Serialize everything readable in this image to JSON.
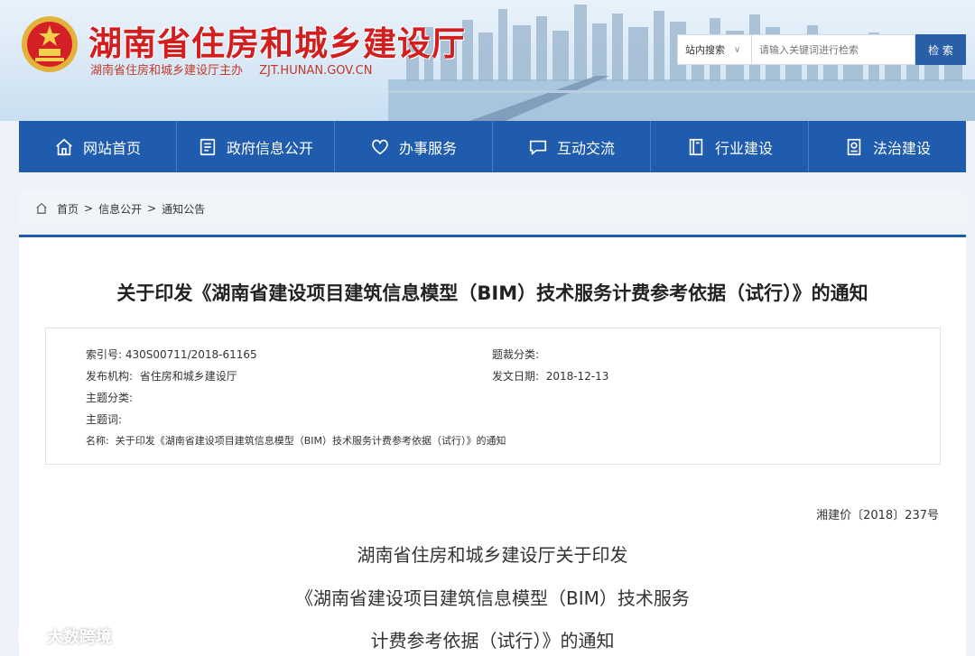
{
  "header": {
    "site_title": "湖南省住房和城乡建设厅",
    "sponsor": "湖南省住房和城乡建设厅主办",
    "domain": "ZJT.HUNAN.GOV.CN",
    "search_scope": "站内搜索",
    "search_placeholder": "请输入关键词进行检索",
    "search_button": "检 索"
  },
  "nav": {
    "items": [
      {
        "label": "网站首页",
        "icon": "home-icon"
      },
      {
        "label": "政府信息公开",
        "icon": "document-icon"
      },
      {
        "label": "办事服务",
        "icon": "heart-icon"
      },
      {
        "label": "互动交流",
        "icon": "chat-icon"
      },
      {
        "label": "行业建设",
        "icon": "book-icon"
      },
      {
        "label": "法治建设",
        "icon": "law-icon"
      }
    ]
  },
  "breadcrumb": {
    "items": [
      "首页",
      "信息公开",
      "通知公告"
    ],
    "sep": ">"
  },
  "article": {
    "title": "关于印发《湖南省建设项目建筑信息模型（BIM）技术服务计费参考依据（试行）》的通知",
    "meta": {
      "index_label": "索引号:",
      "index_value": "430S00711/2018-61165",
      "genre_label": "题裁分类:",
      "genre_value": "",
      "publisher_label": "发布机构:",
      "publisher_value": "省住房和城乡建设厅",
      "date_label": "发文日期:",
      "date_value": "2018-12-13",
      "topic_label": "主题分类:",
      "topic_value": "",
      "keywords_label": "主题词:",
      "keywords_value": "",
      "name_label": "名称:",
      "name_value": "关于印发《湖南省建设项目建筑信息模型（BIM）技术服务计费参考依据（试行）》的通知"
    },
    "doc_number": "湘建价〔2018〕237号",
    "heading_lines": [
      "湖南省住房和城乡建设厅关于印发",
      "《湖南省建设项目建筑信息模型（BIM）技术服务",
      "计费参考依据（试行）》的通知"
    ]
  },
  "watermark": "大数跨境",
  "colors": {
    "nav_blue": "#1f5cae",
    "title_red": "#d11f1f",
    "search_button": "#2a5ea6"
  }
}
